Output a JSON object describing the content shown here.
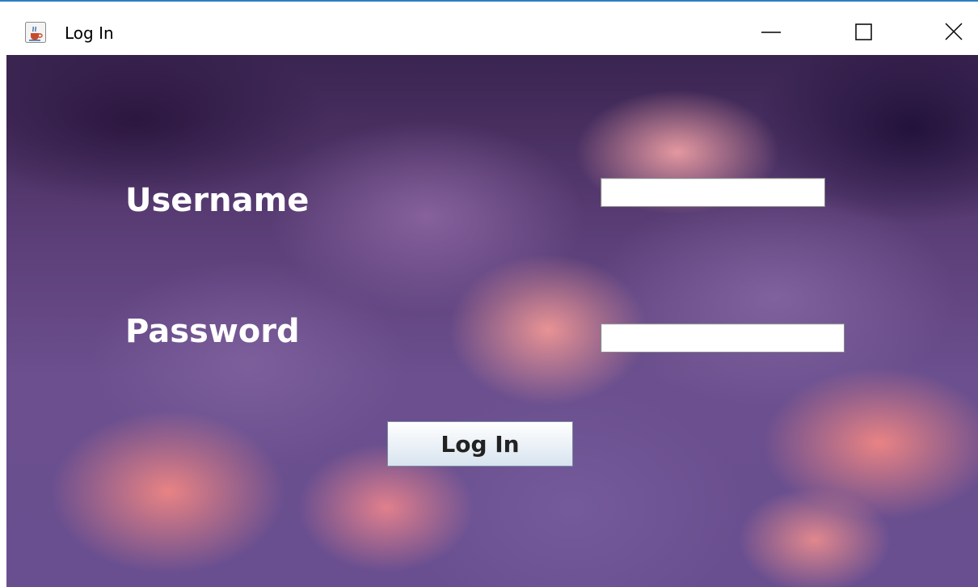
{
  "window": {
    "title": "Log In",
    "app_icon": "java-coffee-cup-icon",
    "controls": {
      "minimize_icon": "minimize-icon",
      "maximize_icon": "maximize-icon",
      "close_icon": "close-icon"
    }
  },
  "form": {
    "username_label": "Username",
    "username_value": "",
    "password_label": "Password",
    "password_value": "",
    "login_button_label": "Log In"
  },
  "colors": {
    "label_text": "#ffffff",
    "title_bar_accent": "#2b7fc1",
    "background_theme": "#6b4f8e"
  }
}
